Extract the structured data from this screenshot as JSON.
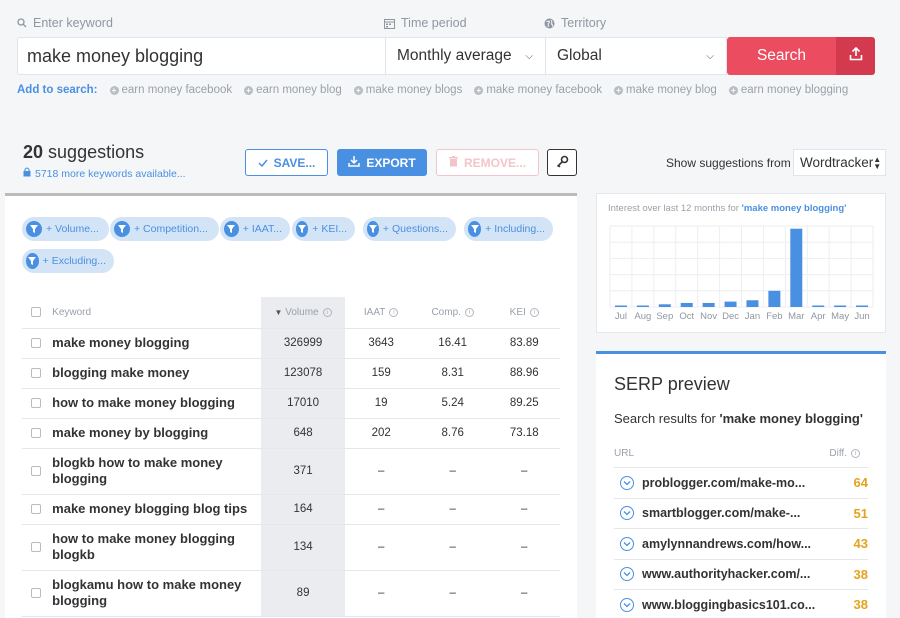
{
  "search": {
    "keyword_label": "Enter keyword",
    "period_label": "Time period",
    "territory_label": "Territory",
    "keyword_value": "make money blogging",
    "period_value": "Monthly average",
    "territory_value": "Global",
    "search_button": "Search"
  },
  "add_to_search": {
    "title": "Add to search:",
    "items": [
      "earn money facebook",
      "earn money blog",
      "make money blogs",
      "make money facebook",
      "make money blog",
      "earn money blogging"
    ]
  },
  "suggestions": {
    "count": "20",
    "label": "suggestions",
    "more": "5718 more keywords available..."
  },
  "toolbar": {
    "save": "SAVE...",
    "export": "EXPORT",
    "remove": "REMOVE..."
  },
  "source": {
    "label": "Show suggestions from",
    "value": "Wordtracker"
  },
  "filters": [
    "+ Volume...",
    "+ Competition...",
    "+ IAAT...",
    "+ KEI...",
    "+ Questions...",
    "+ Including...",
    "+ Excluding..."
  ],
  "table": {
    "headers": {
      "keyword": "Keyword",
      "volume": "Volume",
      "iaat": "IAAT",
      "comp": "Comp.",
      "kei": "KEI"
    },
    "rows": [
      {
        "keyword": "make money blogging",
        "volume": "326999",
        "iaat": "3643",
        "comp": "16.41",
        "kei": "83.89"
      },
      {
        "keyword": "blogging make money",
        "volume": "123078",
        "iaat": "159",
        "comp": "8.31",
        "kei": "88.96"
      },
      {
        "keyword": "how to make money blogging",
        "volume": "17010",
        "iaat": "19",
        "comp": "5.24",
        "kei": "89.25"
      },
      {
        "keyword": "make money by blogging",
        "volume": "648",
        "iaat": "202",
        "comp": "8.76",
        "kei": "73.18"
      },
      {
        "keyword": "blogkb how to make money blogging",
        "volume": "371",
        "iaat": "–",
        "comp": "–",
        "kei": "–"
      },
      {
        "keyword": "make money blogging blog tips",
        "volume": "164",
        "iaat": "–",
        "comp": "–",
        "kei": "–"
      },
      {
        "keyword": "how to make money blogging blogkb",
        "volume": "134",
        "iaat": "–",
        "comp": "–",
        "kei": "–"
      },
      {
        "keyword": "blogkamu how to make money blogging",
        "volume": "89",
        "iaat": "–",
        "comp": "–",
        "kei": "–"
      }
    ]
  },
  "trend": {
    "title_prefix": "Interest over last 12 months for",
    "title_keyword": "'make money blogging'",
    "bar_color": "#4a90e2",
    "months": [
      "Jul",
      "Aug",
      "Sep",
      "Oct",
      "Nov",
      "Dec",
      "Jan",
      "Feb",
      "Mar",
      "Apr",
      "May",
      "Jun"
    ],
    "values": [
      1,
      1,
      2,
      3,
      3,
      4,
      5,
      12,
      58,
      1,
      1,
      1
    ]
  },
  "serp": {
    "title": "SERP preview",
    "subtitle_prefix": "Search results for",
    "subtitle_keyword": "'make money blogging'",
    "col_url": "URL",
    "col_diff": "Diff.",
    "diff_color": "#e6a21c",
    "rows": [
      {
        "url": "problogger.com/make-mo...",
        "diff": "64"
      },
      {
        "url": "smartblogger.com/make-...",
        "diff": "51"
      },
      {
        "url": "amylynnandrews.com/how...",
        "diff": "43"
      },
      {
        "url": "www.authorityhacker.com/...",
        "diff": "38"
      },
      {
        "url": "www.bloggingbasics101.co...",
        "diff": "38"
      }
    ]
  },
  "colors": {
    "accent": "#4a90e2",
    "search": "#ec4c5f",
    "search_dark": "#d43a4e",
    "filter_bg": "#d4e4f7"
  }
}
